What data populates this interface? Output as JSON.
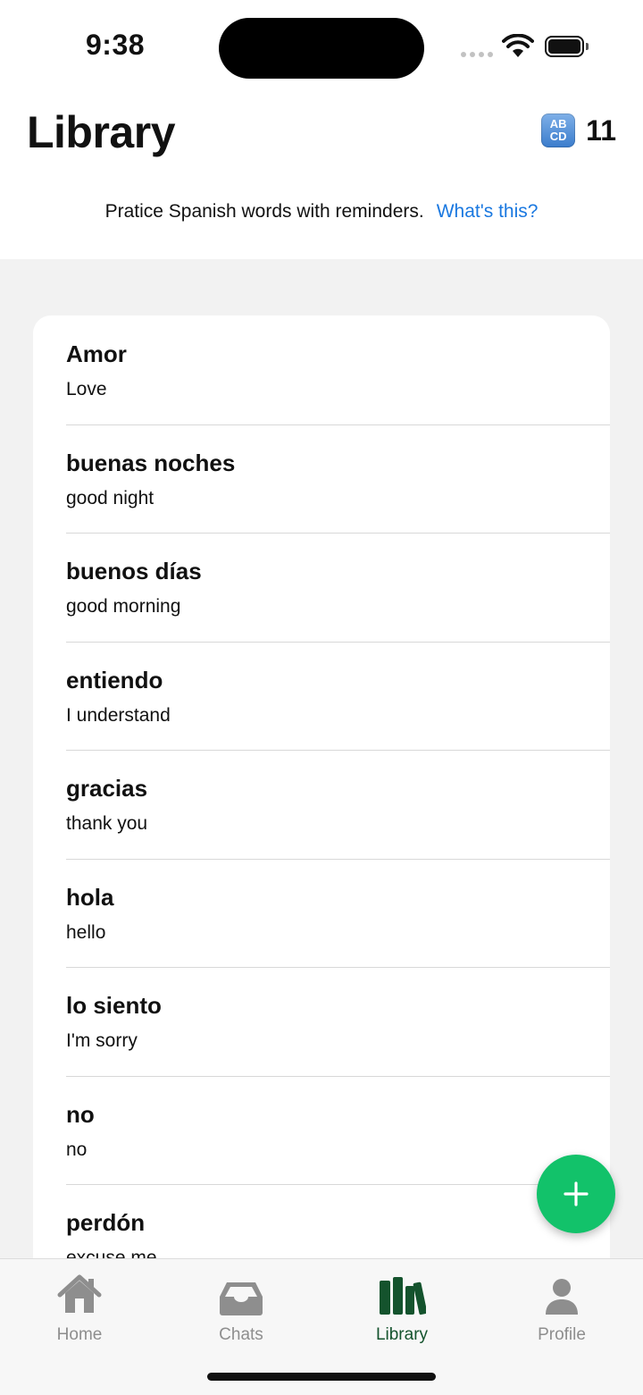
{
  "status_bar": {
    "time": "9:38"
  },
  "header": {
    "title": "Library",
    "counter_icon": "abcd-icon",
    "counter_icon_text_top": "AB",
    "counter_icon_text_bottom": "CD",
    "count": "11",
    "subtitle": "Pratice Spanish words with reminders.",
    "help_link": "What's this?"
  },
  "words": [
    {
      "word": "Amor",
      "meaning": "Love"
    },
    {
      "word": "buenas noches",
      "meaning": "good night"
    },
    {
      "word": "buenos días",
      "meaning": "good morning"
    },
    {
      "word": "entiendo",
      "meaning": "I understand"
    },
    {
      "word": "gracias",
      "meaning": "thank you"
    },
    {
      "word": "hola",
      "meaning": "hello"
    },
    {
      "word": "lo siento",
      "meaning": "I'm sorry"
    },
    {
      "word": "no",
      "meaning": "no"
    },
    {
      "word": "perdón",
      "meaning": "excuse me"
    }
  ],
  "fab": {
    "icon": "plus-icon"
  },
  "tabs": [
    {
      "label": "Home",
      "icon": "house-icon"
    },
    {
      "label": "Chats",
      "icon": "inbox-tray-icon"
    },
    {
      "label": "Library",
      "icon": "books-icon",
      "active": true
    },
    {
      "label": "Profile",
      "icon": "person-icon"
    }
  ],
  "colors": {
    "accent_green": "#12c26a",
    "active_tab": "#14532d",
    "link_blue": "#1a78e0",
    "inactive_tab": "#8e8e8e"
  }
}
